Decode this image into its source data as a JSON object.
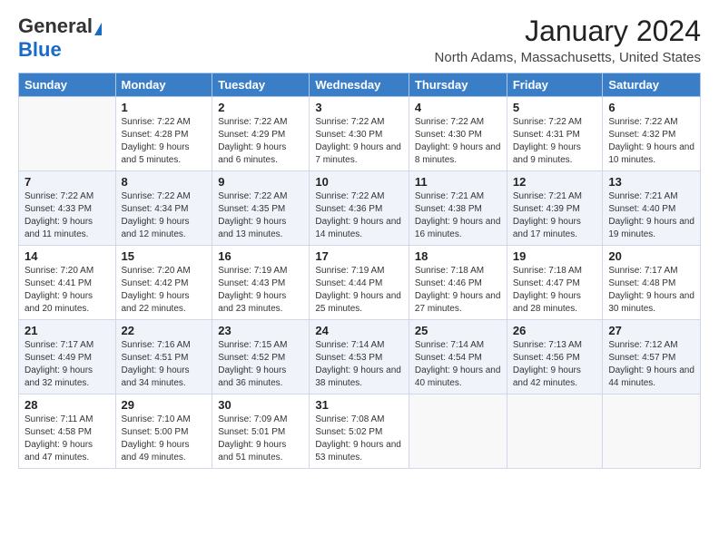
{
  "logo": {
    "line1": "General",
    "line2": "Blue"
  },
  "header": {
    "month": "January 2024",
    "location": "North Adams, Massachusetts, United States"
  },
  "weekdays": [
    "Sunday",
    "Monday",
    "Tuesday",
    "Wednesday",
    "Thursday",
    "Friday",
    "Saturday"
  ],
  "weeks": [
    [
      {
        "day": null
      },
      {
        "day": "1",
        "sunrise": "Sunrise: 7:22 AM",
        "sunset": "Sunset: 4:28 PM",
        "daylight": "Daylight: 9 hours and 5 minutes."
      },
      {
        "day": "2",
        "sunrise": "Sunrise: 7:22 AM",
        "sunset": "Sunset: 4:29 PM",
        "daylight": "Daylight: 9 hours and 6 minutes."
      },
      {
        "day": "3",
        "sunrise": "Sunrise: 7:22 AM",
        "sunset": "Sunset: 4:30 PM",
        "daylight": "Daylight: 9 hours and 7 minutes."
      },
      {
        "day": "4",
        "sunrise": "Sunrise: 7:22 AM",
        "sunset": "Sunset: 4:30 PM",
        "daylight": "Daylight: 9 hours and 8 minutes."
      },
      {
        "day": "5",
        "sunrise": "Sunrise: 7:22 AM",
        "sunset": "Sunset: 4:31 PM",
        "daylight": "Daylight: 9 hours and 9 minutes."
      },
      {
        "day": "6",
        "sunrise": "Sunrise: 7:22 AM",
        "sunset": "Sunset: 4:32 PM",
        "daylight": "Daylight: 9 hours and 10 minutes."
      }
    ],
    [
      {
        "day": "7",
        "sunrise": "Sunrise: 7:22 AM",
        "sunset": "Sunset: 4:33 PM",
        "daylight": "Daylight: 9 hours and 11 minutes."
      },
      {
        "day": "8",
        "sunrise": "Sunrise: 7:22 AM",
        "sunset": "Sunset: 4:34 PM",
        "daylight": "Daylight: 9 hours and 12 minutes."
      },
      {
        "day": "9",
        "sunrise": "Sunrise: 7:22 AM",
        "sunset": "Sunset: 4:35 PM",
        "daylight": "Daylight: 9 hours and 13 minutes."
      },
      {
        "day": "10",
        "sunrise": "Sunrise: 7:22 AM",
        "sunset": "Sunset: 4:36 PM",
        "daylight": "Daylight: 9 hours and 14 minutes."
      },
      {
        "day": "11",
        "sunrise": "Sunrise: 7:21 AM",
        "sunset": "Sunset: 4:38 PM",
        "daylight": "Daylight: 9 hours and 16 minutes."
      },
      {
        "day": "12",
        "sunrise": "Sunrise: 7:21 AM",
        "sunset": "Sunset: 4:39 PM",
        "daylight": "Daylight: 9 hours and 17 minutes."
      },
      {
        "day": "13",
        "sunrise": "Sunrise: 7:21 AM",
        "sunset": "Sunset: 4:40 PM",
        "daylight": "Daylight: 9 hours and 19 minutes."
      }
    ],
    [
      {
        "day": "14",
        "sunrise": "Sunrise: 7:20 AM",
        "sunset": "Sunset: 4:41 PM",
        "daylight": "Daylight: 9 hours and 20 minutes."
      },
      {
        "day": "15",
        "sunrise": "Sunrise: 7:20 AM",
        "sunset": "Sunset: 4:42 PM",
        "daylight": "Daylight: 9 hours and 22 minutes."
      },
      {
        "day": "16",
        "sunrise": "Sunrise: 7:19 AM",
        "sunset": "Sunset: 4:43 PM",
        "daylight": "Daylight: 9 hours and 23 minutes."
      },
      {
        "day": "17",
        "sunrise": "Sunrise: 7:19 AM",
        "sunset": "Sunset: 4:44 PM",
        "daylight": "Daylight: 9 hours and 25 minutes."
      },
      {
        "day": "18",
        "sunrise": "Sunrise: 7:18 AM",
        "sunset": "Sunset: 4:46 PM",
        "daylight": "Daylight: 9 hours and 27 minutes."
      },
      {
        "day": "19",
        "sunrise": "Sunrise: 7:18 AM",
        "sunset": "Sunset: 4:47 PM",
        "daylight": "Daylight: 9 hours and 28 minutes."
      },
      {
        "day": "20",
        "sunrise": "Sunrise: 7:17 AM",
        "sunset": "Sunset: 4:48 PM",
        "daylight": "Daylight: 9 hours and 30 minutes."
      }
    ],
    [
      {
        "day": "21",
        "sunrise": "Sunrise: 7:17 AM",
        "sunset": "Sunset: 4:49 PM",
        "daylight": "Daylight: 9 hours and 32 minutes."
      },
      {
        "day": "22",
        "sunrise": "Sunrise: 7:16 AM",
        "sunset": "Sunset: 4:51 PM",
        "daylight": "Daylight: 9 hours and 34 minutes."
      },
      {
        "day": "23",
        "sunrise": "Sunrise: 7:15 AM",
        "sunset": "Sunset: 4:52 PM",
        "daylight": "Daylight: 9 hours and 36 minutes."
      },
      {
        "day": "24",
        "sunrise": "Sunrise: 7:14 AM",
        "sunset": "Sunset: 4:53 PM",
        "daylight": "Daylight: 9 hours and 38 minutes."
      },
      {
        "day": "25",
        "sunrise": "Sunrise: 7:14 AM",
        "sunset": "Sunset: 4:54 PM",
        "daylight": "Daylight: 9 hours and 40 minutes."
      },
      {
        "day": "26",
        "sunrise": "Sunrise: 7:13 AM",
        "sunset": "Sunset: 4:56 PM",
        "daylight": "Daylight: 9 hours and 42 minutes."
      },
      {
        "day": "27",
        "sunrise": "Sunrise: 7:12 AM",
        "sunset": "Sunset: 4:57 PM",
        "daylight": "Daylight: 9 hours and 44 minutes."
      }
    ],
    [
      {
        "day": "28",
        "sunrise": "Sunrise: 7:11 AM",
        "sunset": "Sunset: 4:58 PM",
        "daylight": "Daylight: 9 hours and 47 minutes."
      },
      {
        "day": "29",
        "sunrise": "Sunrise: 7:10 AM",
        "sunset": "Sunset: 5:00 PM",
        "daylight": "Daylight: 9 hours and 49 minutes."
      },
      {
        "day": "30",
        "sunrise": "Sunrise: 7:09 AM",
        "sunset": "Sunset: 5:01 PM",
        "daylight": "Daylight: 9 hours and 51 minutes."
      },
      {
        "day": "31",
        "sunrise": "Sunrise: 7:08 AM",
        "sunset": "Sunset: 5:02 PM",
        "daylight": "Daylight: 9 hours and 53 minutes."
      },
      {
        "day": null
      },
      {
        "day": null
      },
      {
        "day": null
      }
    ]
  ]
}
